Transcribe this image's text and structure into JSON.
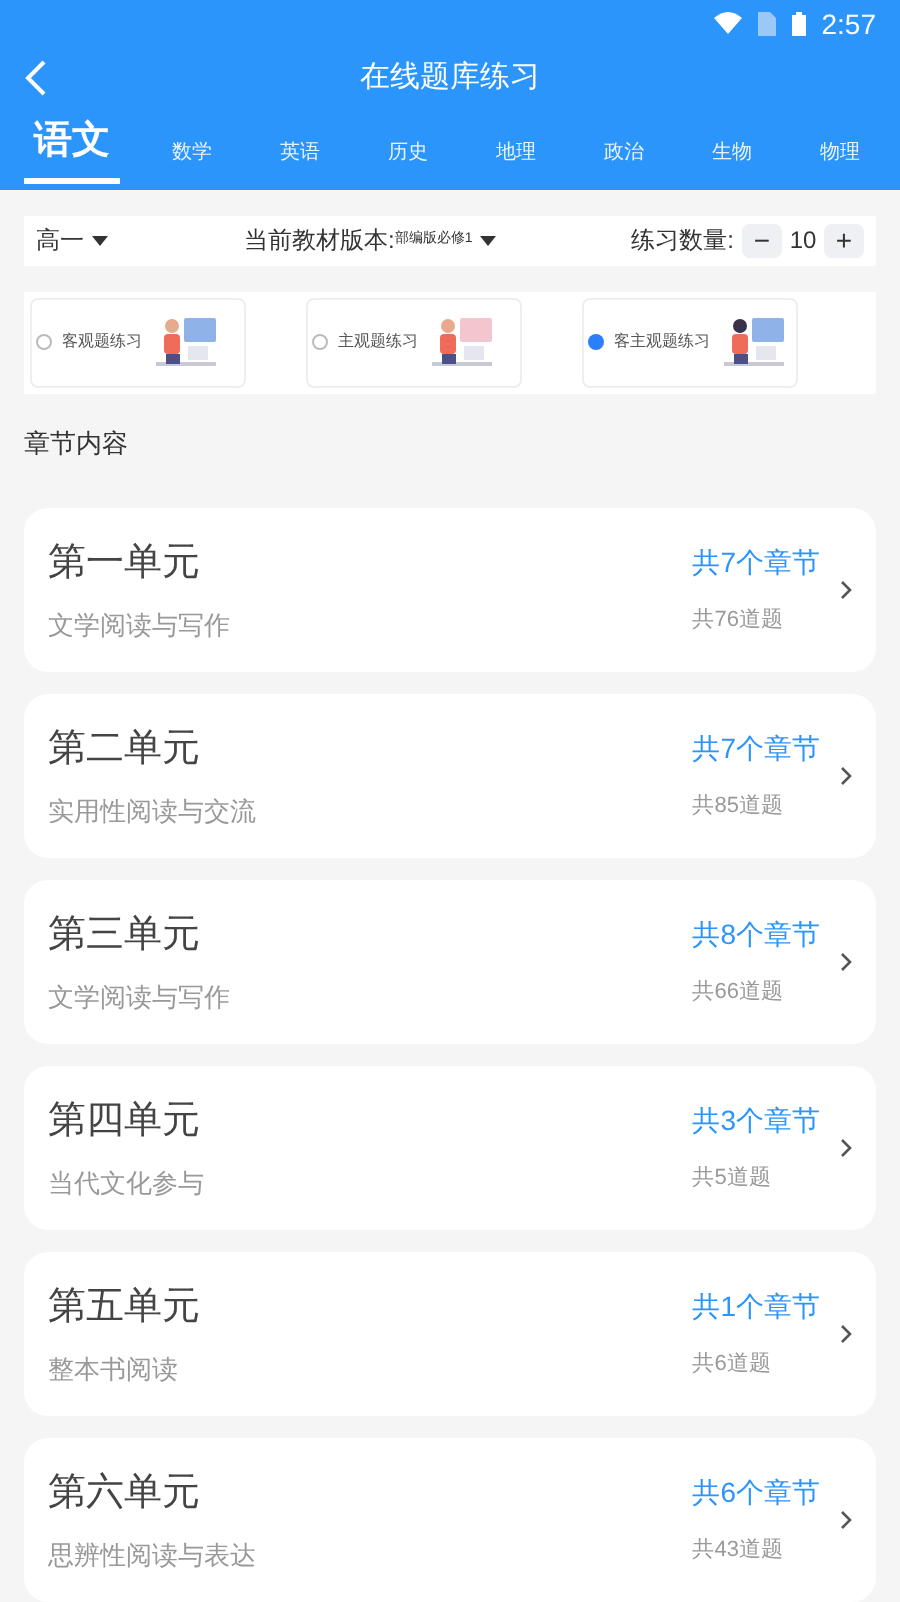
{
  "status_bar": {
    "time": "2:57"
  },
  "header": {
    "title": "在线题库练习"
  },
  "subject_tabs": [
    {
      "label": "语文",
      "selected": true
    },
    {
      "label": "数学",
      "selected": false
    },
    {
      "label": "英语",
      "selected": false
    },
    {
      "label": "历史",
      "selected": false
    },
    {
      "label": "地理",
      "selected": false
    },
    {
      "label": "政治",
      "selected": false
    },
    {
      "label": "生物",
      "selected": false
    },
    {
      "label": "物理",
      "selected": false
    }
  ],
  "filters": {
    "grade": "高一",
    "edition_label": "当前教材版本:",
    "edition": "部编版必修1",
    "count_label": "练习数量:",
    "minus": "−",
    "count": "10",
    "plus": "+"
  },
  "practice_types": [
    {
      "label": "客观题练习",
      "selected": false
    },
    {
      "label": "主观题练习",
      "selected": false
    },
    {
      "label": "客主观题练习",
      "selected": true
    }
  ],
  "section_title": "章节内容",
  "units": [
    {
      "title": "第一单元",
      "subtitle": "文学阅读与写作",
      "chapters": "共7个章节",
      "questions": "共76道题"
    },
    {
      "title": "第二单元",
      "subtitle": "实用性阅读与交流",
      "chapters": "共7个章节",
      "questions": "共85道题"
    },
    {
      "title": "第三单元",
      "subtitle": "文学阅读与写作",
      "chapters": "共8个章节",
      "questions": "共66道题"
    },
    {
      "title": "第四单元",
      "subtitle": "当代文化参与",
      "chapters": "共3个章节",
      "questions": "共5道题"
    },
    {
      "title": "第五单元",
      "subtitle": "整本书阅读",
      "chapters": "共1个章节",
      "questions": "共6道题"
    },
    {
      "title": "第六单元",
      "subtitle": "思辨性阅读与表达",
      "chapters": "共6个章节",
      "questions": "共43道题"
    }
  ]
}
